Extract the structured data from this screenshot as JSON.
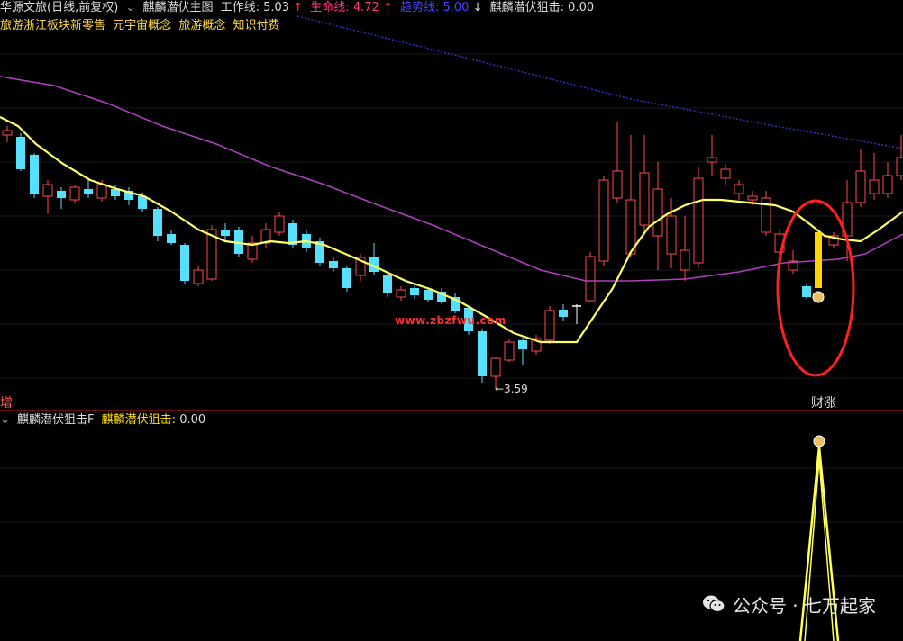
{
  "header": {
    "stock_name": "华源文旅(日线,前复权)",
    "indicator_name": "麒麟潜伏主图",
    "work_line_label": "工作线:",
    "work_line_value": "5.03",
    "work_line_arrow": "↑",
    "life_line_label": "生命线:",
    "life_line_value": "4.72",
    "life_line_arrow": "↑",
    "trend_line_label": "趋势线:",
    "trend_line_value": "5.00",
    "trend_line_arrow": "↓",
    "snipe_label": "麒麟潜伏狙击:",
    "snipe_value": "0.00",
    "colors": {
      "work": "#ffff60",
      "life": "#ff4040",
      "trend": "#3a3aff",
      "snipe": "#ffe000"
    }
  },
  "concepts": [
    "旅游浙江板块新零售",
    "元宇宙概念",
    "旅游概念",
    "知识付费"
  ],
  "main_panel": {
    "left_marker": "增",
    "low_label": "←3.59",
    "signal_label": "财涨",
    "site_text": "www.zbzfwu.com"
  },
  "sub_panel": {
    "indicator_name": "麒麟潜伏狙击F",
    "snipe_label": "麒麟潜伏狙击:",
    "snipe_value": "0.00"
  },
  "watermark": {
    "text": "公众号 · 七万起家",
    "icon": "wechat-icon"
  }
}
